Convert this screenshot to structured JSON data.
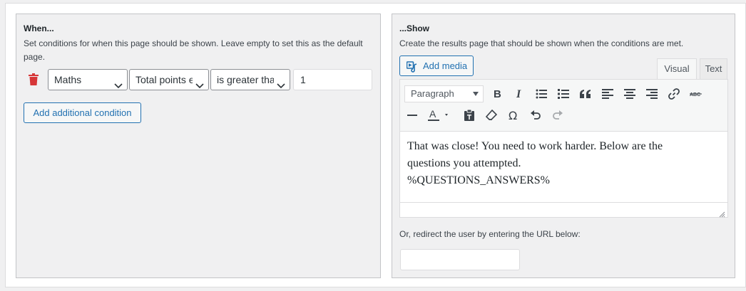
{
  "when": {
    "title": "When...",
    "description": "Set conditions for when this page should be shown. Leave empty to set this as the default page.",
    "condition": {
      "subject": "Maths",
      "metric": "Total points earned",
      "operator": "is greater than",
      "value": "1"
    },
    "add_condition_label": "Add additional condition"
  },
  "show": {
    "title": "...Show",
    "description": "Create the results page that should be shown when the conditions are met.",
    "add_media_label": "Add media",
    "tabs": [
      {
        "label": "Visual"
      },
      {
        "label": "Text"
      }
    ],
    "format_select": "Paragraph",
    "content_lines": [
      "That was close! You need to work harder. Below are the",
      "questions you attempted.",
      "%QUESTIONS_ANSWERS%"
    ],
    "redirect_label": "Or, redirect the user by entering the URL below:",
    "redirect_value": ""
  },
  "colors": {
    "accent": "#2271b1",
    "danger": "#d63638",
    "panel_bg": "#f0f0f1"
  }
}
